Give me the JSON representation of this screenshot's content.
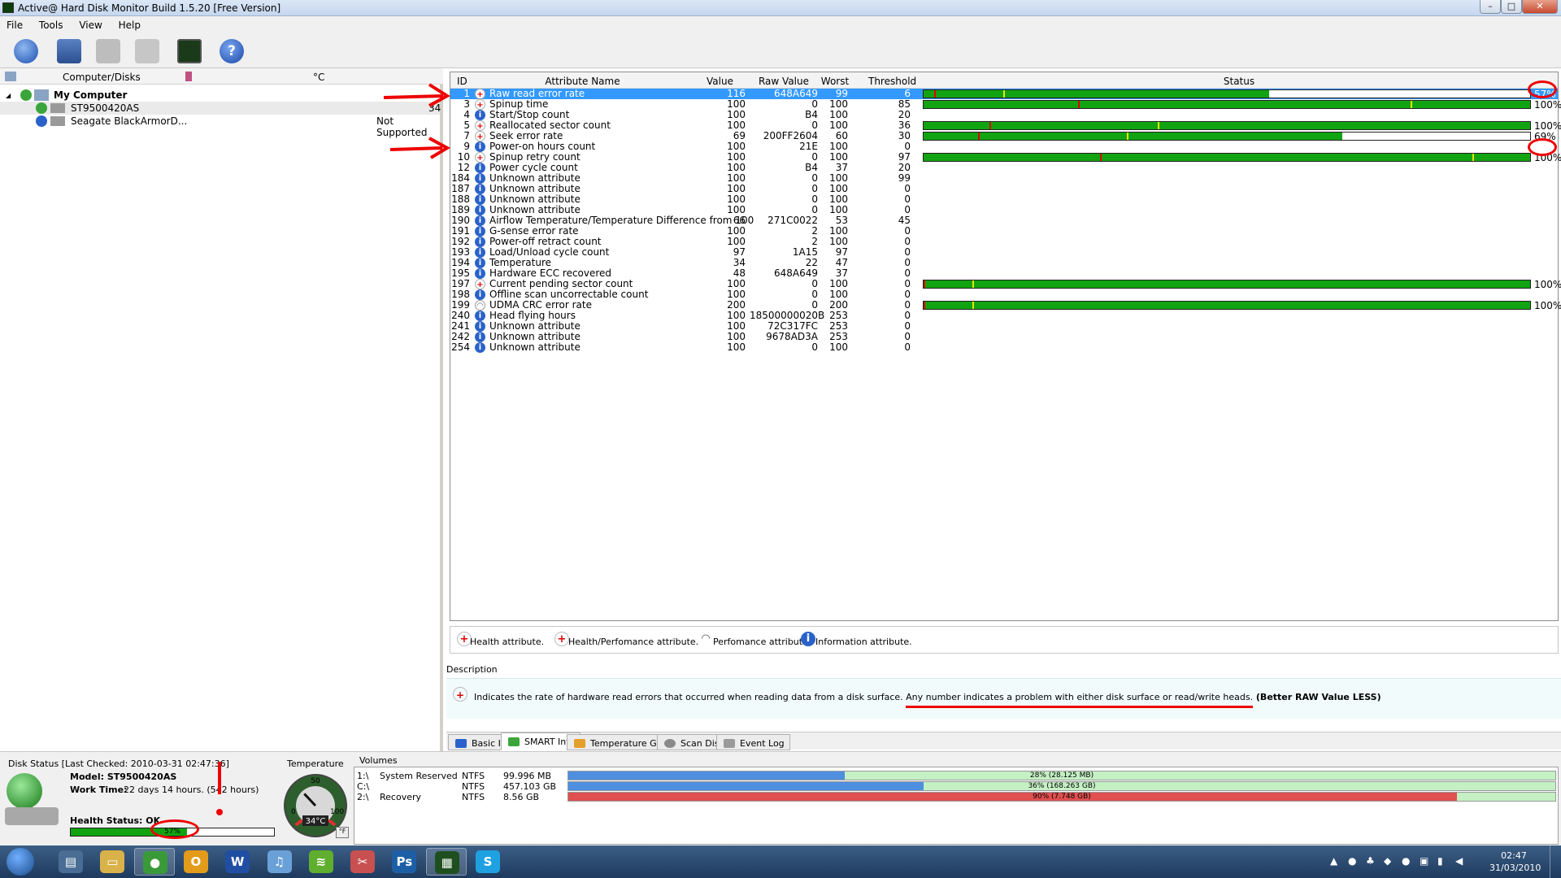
{
  "window": {
    "title": "Active@ Hard Disk Monitor Build 1.5.20 [Free Version]",
    "min_glyph": "–",
    "max_glyph": "□",
    "close_glyph": "✕"
  },
  "menu": [
    "File",
    "Tools",
    "View",
    "Help"
  ],
  "toolbar": {
    "buttons": [
      "refresh-icon",
      "add-disk-icon",
      "remove-disk-icon",
      "close-disk-icon",
      "monitor-icon",
      "help-icon"
    ],
    "help_glyph": "?"
  },
  "left_panel": {
    "col_computer": "Computer/Disks",
    "col_temp": "°C",
    "tree": [
      {
        "label": "My Computer",
        "temp": ""
      },
      {
        "label": "ST9500420AS",
        "temp": "34"
      },
      {
        "label": "Seagate BlackArmorD...",
        "temp": "Not Supported"
      }
    ],
    "expand_glyph": "◢"
  },
  "attributes": {
    "columns": [
      "ID",
      "Attribute Name",
      "Value",
      "Raw Value",
      "Worst",
      "Threshold",
      "Status"
    ],
    "rows": [
      {
        "id": "1",
        "name": "Raw read error rate",
        "value": "116",
        "raw": "648A649",
        "worst": "99",
        "threshold": "6",
        "type": "health",
        "pct": "57%",
        "fill": 57,
        "selected": true
      },
      {
        "id": "3",
        "name": "Spinup time",
        "value": "100",
        "raw": "0",
        "worst": "100",
        "threshold": "85",
        "type": "health",
        "pct": "100%",
        "fill": 100
      },
      {
        "id": "4",
        "name": "Start/Stop count",
        "value": "100",
        "raw": "B4",
        "worst": "100",
        "threshold": "20",
        "type": "info",
        "pct": "",
        "fill": null
      },
      {
        "id": "5",
        "name": "Reallocated sector count",
        "value": "100",
        "raw": "0",
        "worst": "100",
        "threshold": "36",
        "type": "health",
        "pct": "100%",
        "fill": 100
      },
      {
        "id": "7",
        "name": "Seek error rate",
        "value": "69",
        "raw": "200FF2604",
        "worst": "60",
        "threshold": "30",
        "type": "health",
        "pct": "69%",
        "fill": 69
      },
      {
        "id": "9",
        "name": "Power-on hours count",
        "value": "100",
        "raw": "21E",
        "worst": "100",
        "threshold": "0",
        "type": "info",
        "pct": "",
        "fill": null
      },
      {
        "id": "10",
        "name": "Spinup retry count",
        "value": "100",
        "raw": "0",
        "worst": "100",
        "threshold": "97",
        "type": "health",
        "pct": "100%",
        "fill": 100
      },
      {
        "id": "12",
        "name": "Power cycle count",
        "value": "100",
        "raw": "B4",
        "worst": "37",
        "threshold": "20",
        "type": "info",
        "pct": "",
        "fill": null
      },
      {
        "id": "184",
        "name": "Unknown attribute",
        "value": "100",
        "raw": "0",
        "worst": "100",
        "threshold": "99",
        "type": "info",
        "pct": "",
        "fill": null
      },
      {
        "id": "187",
        "name": "Unknown attribute",
        "value": "100",
        "raw": "0",
        "worst": "100",
        "threshold": "0",
        "type": "info",
        "pct": "",
        "fill": null
      },
      {
        "id": "188",
        "name": "Unknown attribute",
        "value": "100",
        "raw": "0",
        "worst": "100",
        "threshold": "0",
        "type": "info",
        "pct": "",
        "fill": null
      },
      {
        "id": "189",
        "name": "Unknown attribute",
        "value": "100",
        "raw": "0",
        "worst": "100",
        "threshold": "0",
        "type": "info",
        "pct": "",
        "fill": null
      },
      {
        "id": "190",
        "name": "Airflow Temperature/Temperature Difference from 100",
        "value": "66",
        "raw": "271C0022",
        "worst": "53",
        "threshold": "45",
        "type": "info",
        "pct": "",
        "fill": null
      },
      {
        "id": "191",
        "name": "G-sense error rate",
        "value": "100",
        "raw": "2",
        "worst": "100",
        "threshold": "0",
        "type": "info",
        "pct": "",
        "fill": null
      },
      {
        "id": "192",
        "name": "Power-off retract count",
        "value": "100",
        "raw": "2",
        "worst": "100",
        "threshold": "0",
        "type": "info",
        "pct": "",
        "fill": null
      },
      {
        "id": "193",
        "name": "Load/Unload cycle count",
        "value": "97",
        "raw": "1A15",
        "worst": "97",
        "threshold": "0",
        "type": "info",
        "pct": "",
        "fill": null
      },
      {
        "id": "194",
        "name": "Temperature",
        "value": "34",
        "raw": "22",
        "worst": "47",
        "threshold": "0",
        "type": "info",
        "pct": "",
        "fill": null
      },
      {
        "id": "195",
        "name": "Hardware ECC recovered",
        "value": "48",
        "raw": "648A649",
        "worst": "37",
        "threshold": "0",
        "type": "info",
        "pct": "",
        "fill": null
      },
      {
        "id": "197",
        "name": "Current pending sector count",
        "value": "100",
        "raw": "0",
        "worst": "100",
        "threshold": "0",
        "type": "health",
        "pct": "100%",
        "fill": 100
      },
      {
        "id": "198",
        "name": "Offline scan uncorrectable count",
        "value": "100",
        "raw": "0",
        "worst": "100",
        "threshold": "0",
        "type": "info",
        "pct": "",
        "fill": null
      },
      {
        "id": "199",
        "name": "UDMA CRC error rate",
        "value": "200",
        "raw": "0",
        "worst": "200",
        "threshold": "0",
        "type": "perf",
        "pct": "100%",
        "fill": 100
      },
      {
        "id": "240",
        "name": "Head flying hours",
        "value": "100",
        "raw": "18500000020B",
        "worst": "253",
        "threshold": "0",
        "type": "info",
        "pct": "",
        "fill": null
      },
      {
        "id": "241",
        "name": "Unknown attribute",
        "value": "100",
        "raw": "72C317FC",
        "worst": "253",
        "threshold": "0",
        "type": "info",
        "pct": "",
        "fill": null
      },
      {
        "id": "242",
        "name": "Unknown attribute",
        "value": "100",
        "raw": "9678AD3A",
        "worst": "253",
        "threshold": "0",
        "type": "info",
        "pct": "",
        "fill": null
      },
      {
        "id": "254",
        "name": "Unknown attribute",
        "value": "100",
        "raw": "0",
        "worst": "100",
        "threshold": "0",
        "type": "info",
        "pct": "",
        "fill": null
      }
    ]
  },
  "legend": {
    "health": "Health attribute.",
    "health_perf": "Health/Perfomance attribute.",
    "perf": "Perfomance attribute.",
    "info": "Information attribute.",
    "health_glyph": "+",
    "perf_glyph": "◠",
    "info_glyph": "i"
  },
  "description": {
    "label": "Description",
    "text_a": "Indicates the rate of hardware read errors that occurred when reading data from a disk surface. ",
    "text_b": "Any number indicates a problem with either disk surface or read/write heads.",
    "text_c": " (Better RAW Value LESS)"
  },
  "tabs": [
    "Basic Info",
    "SMART Info",
    "Temperature Graph",
    "Scan Disk",
    "Event Log"
  ],
  "active_tab": "SMART Info",
  "disk_status": {
    "header": "Disk Status [Last Checked: 2010-03-31 02:47:36]",
    "model_label": "Model: ST9500420AS",
    "work_time_label": "Work Time:",
    "work_time_value": "22 days 14 hours. (542 hours)",
    "health_label": "Health Status: OK",
    "health_pct": "57%",
    "health_fill": 57
  },
  "temperature": {
    "label": "Temperature",
    "reading": "34°C",
    "gauge_value": 34,
    "gauge_top": "50",
    "gauge_left": "0",
    "gauge_right": "100",
    "unit_btn": "°F"
  },
  "volumes": {
    "label": "Volumes",
    "rows": [
      {
        "drive": "1:\\",
        "name": "System Reserved",
        "fs": "NTFS",
        "size": "99.996 MB",
        "usage": "28% (28.125 MB)",
        "fill": 28,
        "color": "#4f8fe0"
      },
      {
        "drive": "C:\\",
        "name": "",
        "fs": "NTFS",
        "size": "457.103 GB",
        "usage": "36% (168.263 GB)",
        "fill": 36,
        "color": "#4f8fe0"
      },
      {
        "drive": "2:\\",
        "name": "Recovery",
        "fs": "NTFS",
        "size": "8.56 GB",
        "usage": "90% (7.748 GB)",
        "fill": 90,
        "color": "#e05050"
      }
    ]
  },
  "taskbar": {
    "time": "02:47",
    "date": "31/03/2010",
    "apps": [
      {
        "icon": "windows-explorer-icon",
        "glyph": "▤",
        "color": "#4a6d95"
      },
      {
        "icon": "folder-icon",
        "glyph": "▭",
        "color": "#d9b24a"
      },
      {
        "icon": "chrome-icon",
        "glyph": "●",
        "color": "#3a9a3a"
      },
      {
        "icon": "outlook-icon",
        "glyph": "O",
        "color": "#e39b1b"
      },
      {
        "icon": "word-icon",
        "glyph": "W",
        "color": "#1f4ea3"
      },
      {
        "icon": "itunes-icon",
        "glyph": "♫",
        "color": "#6aa0d8"
      },
      {
        "icon": "spotify-icon",
        "glyph": "≋",
        "color": "#5fae2e"
      },
      {
        "icon": "snipping-tool-icon",
        "glyph": "✂",
        "color": "#c95050"
      },
      {
        "icon": "photoshop-icon",
        "glyph": "Ps",
        "color": "#1d5fa6"
      },
      {
        "icon": "disk-monitor-icon",
        "glyph": "▦",
        "color": "#1f4f1f"
      },
      {
        "icon": "skype-icon",
        "glyph": "S",
        "color": "#1fa1e1"
      }
    ],
    "tray_glyphs": [
      "▲",
      "●",
      "♣",
      "◆",
      "●",
      "▣",
      "▮",
      "◀"
    ]
  },
  "colors": {
    "bar_fill": "#11a311",
    "bar_tick_red": "#e00000",
    "bar_tick_yellow": "#e8e800",
    "selection": "#3399ff",
    "annotation": "#e00000"
  }
}
